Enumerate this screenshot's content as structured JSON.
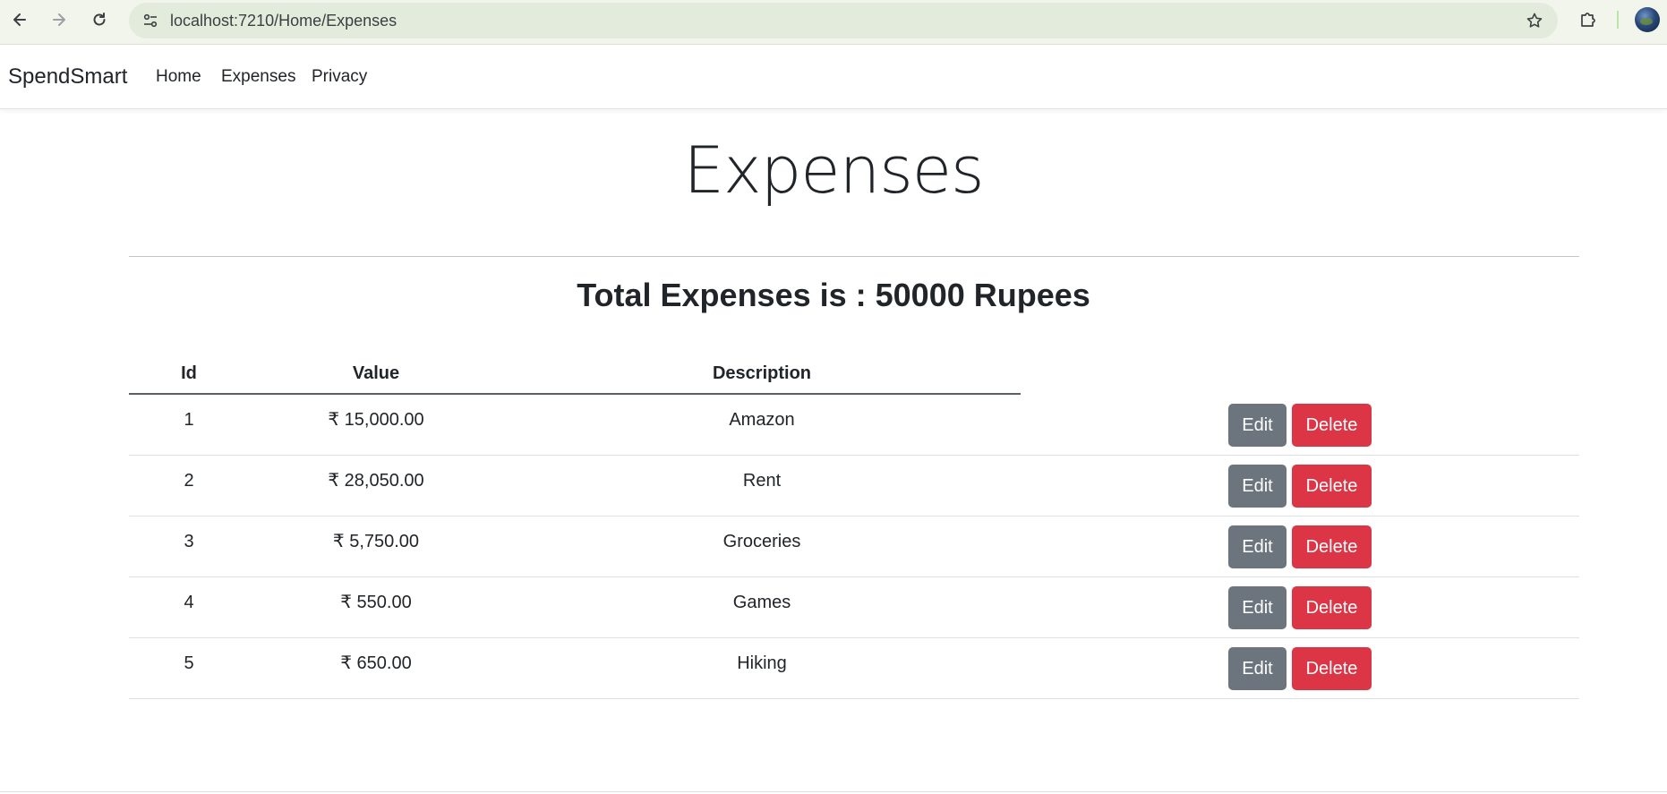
{
  "browser": {
    "url": "localhost:7210/Home/Expenses",
    "icons": [
      "back-arrow-icon",
      "forward-arrow-icon",
      "reload-icon",
      "site-info-icon",
      "bookmark-star-icon",
      "extensions-puzzle-icon",
      "profile-avatar"
    ]
  },
  "navbar": {
    "brand": "SpendSmart",
    "links": [
      "Home",
      "Expenses",
      "Privacy"
    ]
  },
  "page": {
    "title": "Expenses",
    "total": "Total Expenses is : 50000 Rupees"
  },
  "table": {
    "headers": [
      "Id",
      "Value",
      "Description"
    ],
    "rows": [
      {
        "id": "1",
        "value": "₹ 15,000.00",
        "description": "Amazon"
      },
      {
        "id": "2",
        "value": "₹ 28,050.00",
        "description": "Rent"
      },
      {
        "id": "3",
        "value": "₹ 5,750.00",
        "description": "Groceries"
      },
      {
        "id": "4",
        "value": "₹ 550.00",
        "description": "Games"
      },
      {
        "id": "5",
        "value": "₹ 650.00",
        "description": "Hiking"
      }
    ],
    "edit_label": "Edit",
    "delete_label": "Delete"
  },
  "colors": {
    "edit_button": "#6c757d",
    "delete_button": "#dc3545",
    "chrome_bg": "#f1f5ec"
  }
}
